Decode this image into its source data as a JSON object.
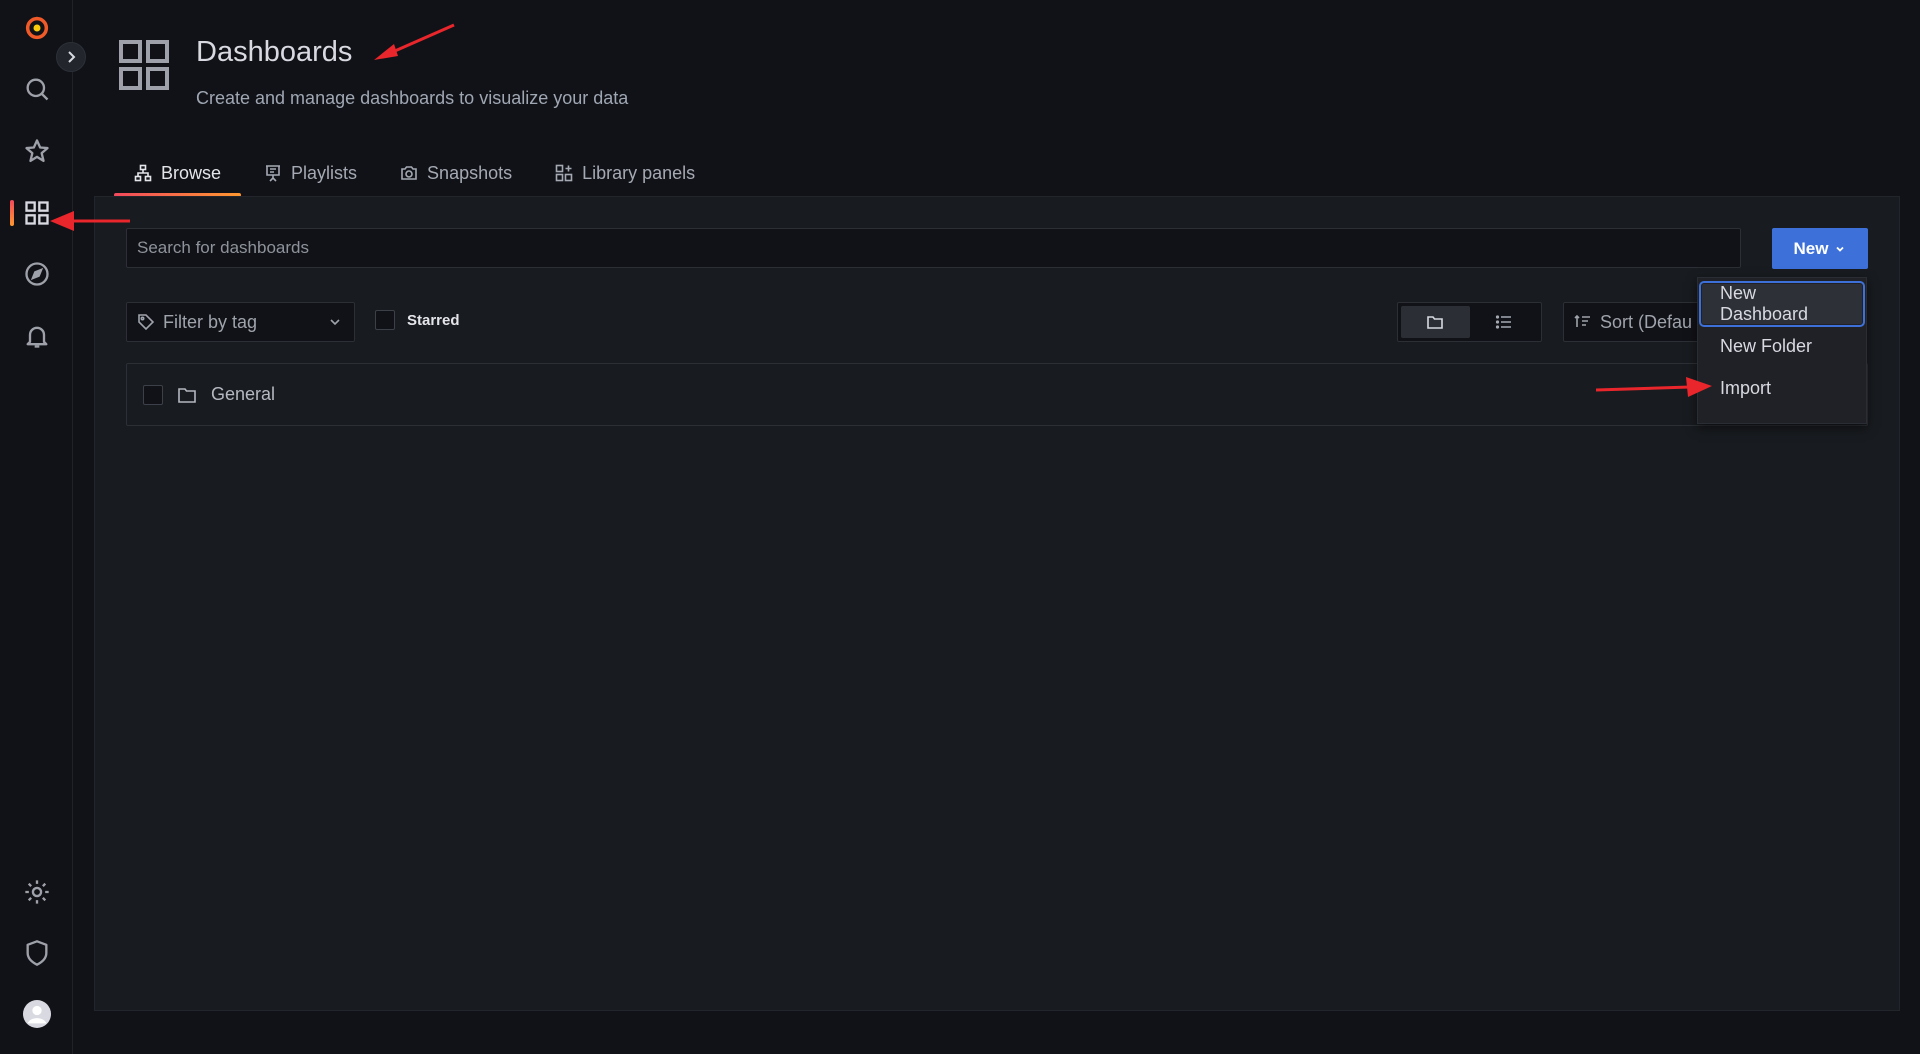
{
  "sidebar": {
    "items": [
      {
        "name": "search",
        "icon": "search-icon"
      },
      {
        "name": "starred",
        "icon": "star-icon"
      },
      {
        "name": "dashboards",
        "icon": "apps-icon",
        "active": true
      },
      {
        "name": "explore",
        "icon": "compass-icon"
      },
      {
        "name": "alerting",
        "icon": "bell-icon"
      },
      {
        "name": "configuration",
        "icon": "gear-icon"
      },
      {
        "name": "server-admin",
        "icon": "shield-icon"
      },
      {
        "name": "profile",
        "icon": "avatar"
      }
    ],
    "logo": "grafana-logo-icon",
    "expand_icon": "chevron-right-icon"
  },
  "header": {
    "title": "Dashboards",
    "subtitle": "Create and manage dashboards to visualize your data"
  },
  "tabs": [
    {
      "label": "Browse",
      "icon": "sitemap-icon",
      "active": true
    },
    {
      "label": "Playlists",
      "icon": "presentation-icon"
    },
    {
      "label": "Snapshots",
      "icon": "camera-icon"
    },
    {
      "label": "Library panels",
      "icon": "library-panel-icon"
    }
  ],
  "browse": {
    "search_placeholder": "Search for dashboards",
    "new_button": "New",
    "filter_tag_placeholder": "Filter by tag",
    "starred_label": "Starred",
    "sort_label": "Sort (Defau",
    "folders": [
      {
        "name": "General"
      }
    ]
  },
  "new_menu": {
    "items": [
      {
        "label": "New Dashboard",
        "focused": true
      },
      {
        "label": "New Folder"
      },
      {
        "label": "Import"
      }
    ]
  },
  "colors": {
    "accent_blue": "#3d71d9",
    "active_gradient_start": "#f2495c",
    "active_gradient_end": "#ff9830",
    "annotation_arrow": "#e8262b",
    "background": "#111217",
    "panel": "#181b1f"
  }
}
